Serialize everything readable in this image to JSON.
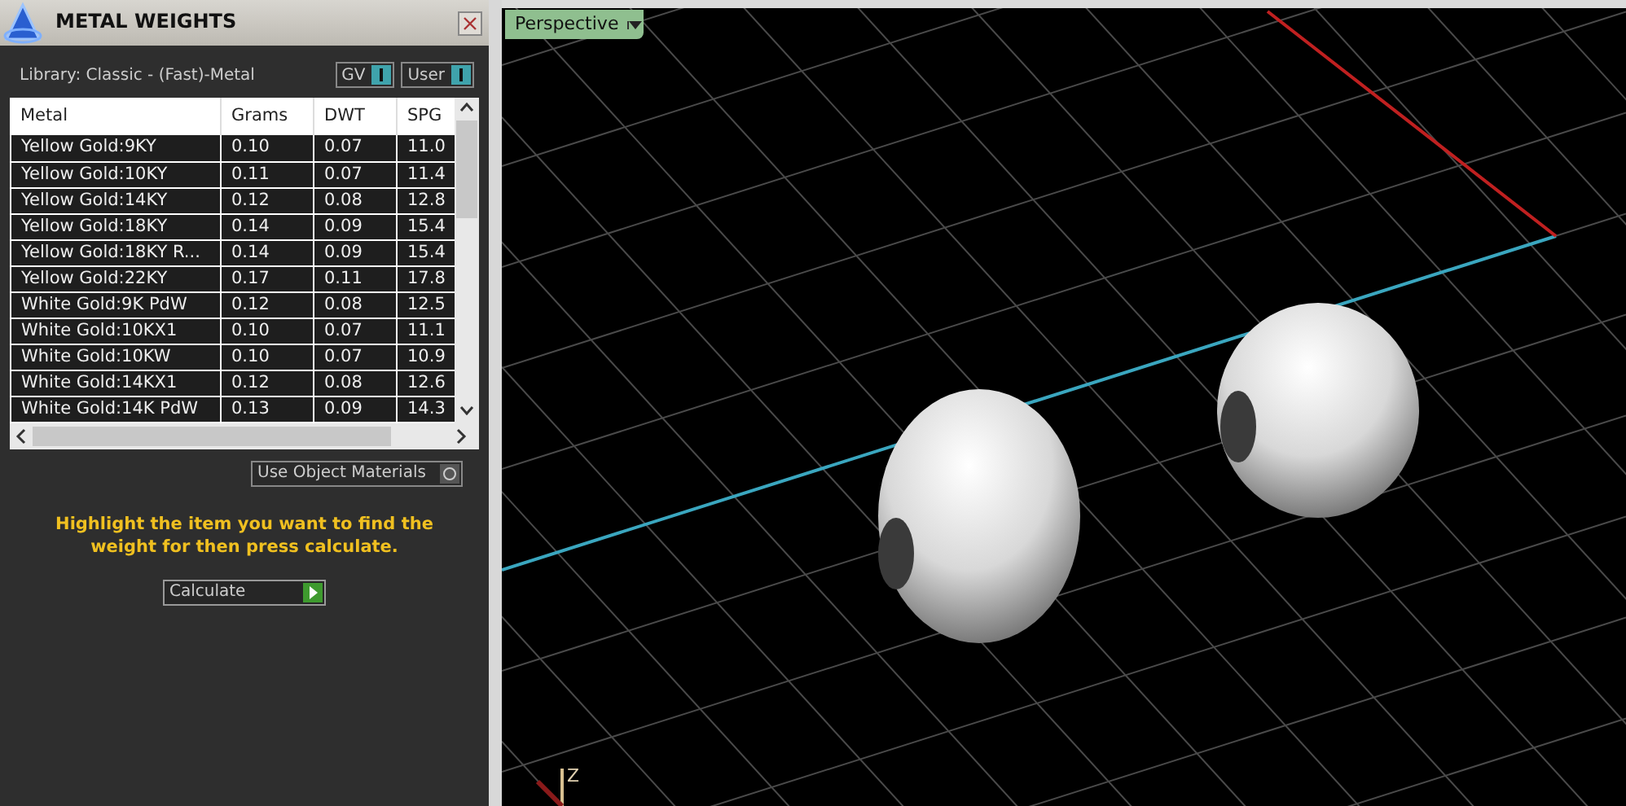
{
  "panel": {
    "title": "METAL WEIGHTS",
    "library": "Library: Classic - (Fast)-Metal",
    "toggles": [
      {
        "label": "GV",
        "on": true
      },
      {
        "label": "User",
        "on": true
      }
    ],
    "table": {
      "columns": [
        "Metal",
        "Grams",
        "DWT",
        "SPG"
      ],
      "rows": [
        [
          "Yellow Gold:9KY",
          "0.10",
          "0.07",
          "11.0"
        ],
        [
          "Yellow Gold:10KY",
          "0.11",
          "0.07",
          "11.4"
        ],
        [
          "Yellow Gold:14KY",
          "0.12",
          "0.08",
          "12.8"
        ],
        [
          "Yellow Gold:18KY",
          "0.14",
          "0.09",
          "15.4"
        ],
        [
          "Yellow Gold:18KY R...",
          "0.14",
          "0.09",
          "15.4"
        ],
        [
          "Yellow Gold:22KY",
          "0.17",
          "0.11",
          "17.8"
        ],
        [
          "White Gold:9K PdW",
          "0.12",
          "0.08",
          "12.5"
        ],
        [
          "White Gold:10KX1",
          "0.10",
          "0.07",
          "11.1"
        ],
        [
          "White Gold:10KW",
          "0.10",
          "0.07",
          "10.9"
        ],
        [
          "White Gold:14KX1",
          "0.12",
          "0.08",
          "12.6"
        ],
        [
          "White Gold:14K PdW",
          "0.13",
          "0.09",
          "14.3"
        ]
      ]
    },
    "option": {
      "label": "Use Object Materials",
      "on": false
    },
    "hint": "Highlight the item you want to find the weight for then press calculate.",
    "button": "Calculate"
  },
  "viewport": {
    "view": "Perspective",
    "axis_label": "Z"
  }
}
